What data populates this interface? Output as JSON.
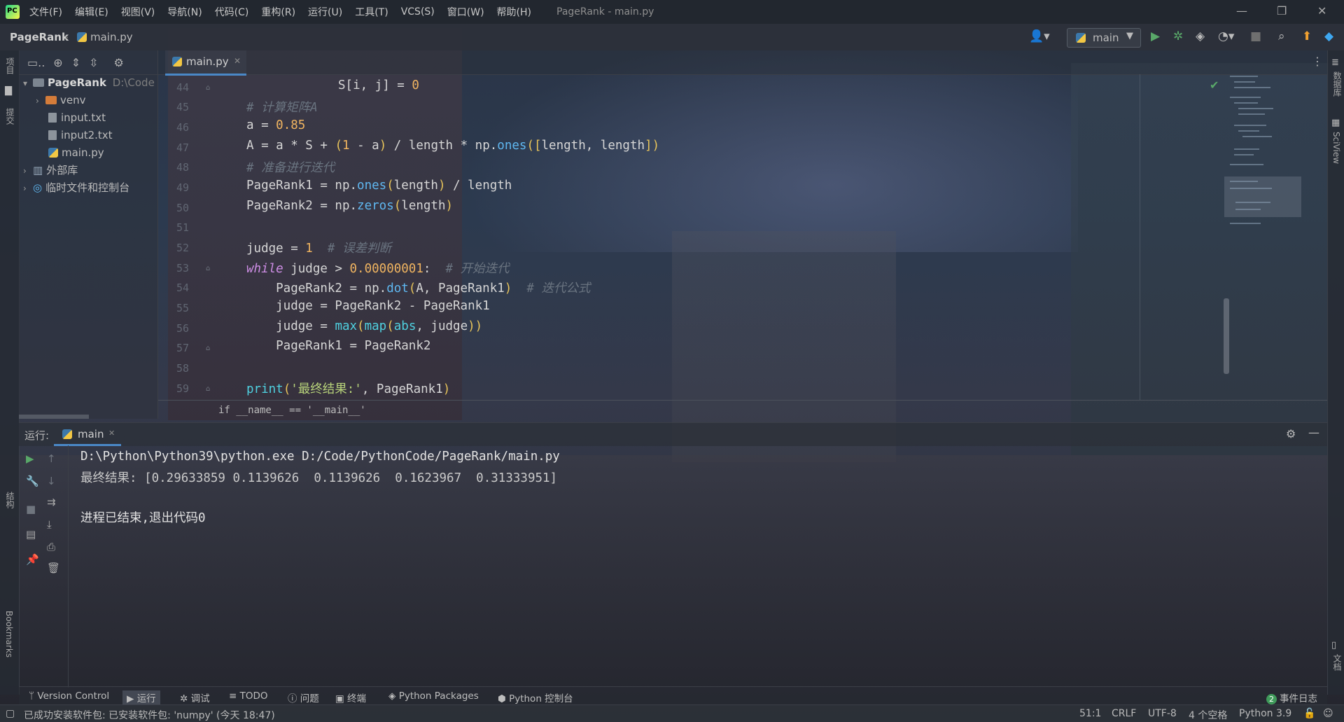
{
  "menubar": {
    "items": [
      "文件(F)",
      "编辑(E)",
      "视图(V)",
      "导航(N)",
      "代码(C)",
      "重构(R)",
      "运行(U)",
      "工具(T)",
      "VCS(S)",
      "窗口(W)",
      "帮助(H)"
    ],
    "window_title": "PageRank - main.py"
  },
  "navbar": {
    "project": "PageRank",
    "file": "main.py",
    "run_config": "main"
  },
  "sidebar_left": {
    "project_label": "项目",
    "structure_label": "结构",
    "bookmarks_label": "Bookmarks"
  },
  "project_tree": {
    "root_name": "PageRank",
    "root_path": "D:\\Code",
    "items": [
      "venv",
      "input.txt",
      "input2.txt",
      "main.py"
    ],
    "external_libs": "外部库",
    "scratches": "临时文件和控制台"
  },
  "editor": {
    "tab_label": "main.py",
    "line_numbers": [
      "44",
      "45",
      "46",
      "47",
      "48",
      "49",
      "50",
      "51",
      "52",
      "53",
      "54",
      "55",
      "56",
      "57",
      "58",
      "59"
    ],
    "breadcrumb": "if __name__ == '__main__'"
  },
  "sidebar_right": {
    "database_label": "数据库",
    "sciview_label": "SciView",
    "docs_label": "文档"
  },
  "run_panel": {
    "label": "运行:",
    "tab": "main",
    "command": "D:\\Python\\Python39\\python.exe D:/Code/PythonCode/PageRank/main.py",
    "result": "最终结果: [0.29633859 0.1139626  0.1139626  0.1623967  0.31333951]",
    "exit_msg": "进程已结束,退出代码0"
  },
  "tool_windows": {
    "items": [
      "Version Control",
      "运行",
      "调试",
      "TODO",
      "问题",
      "终端",
      "Python Packages",
      "Python 控制台"
    ],
    "event_log_count": "2",
    "event_log": "事件日志"
  },
  "statusbar": {
    "message": "已成功安装软件包: 已安装软件包: 'numpy' (今天 18:47)",
    "position": "51:1",
    "line_sep": "CRLF",
    "encoding": "UTF-8",
    "indent": "4 个空格",
    "interpreter": "Python 3.9"
  },
  "colors": {
    "accent": "#4a88c7",
    "keyword": "#cf8ee6",
    "number": "#f0b460",
    "function": "#5fb7f0",
    "string": "#b7d27a",
    "comment": "#6a7480",
    "run_green": "#59a869"
  }
}
